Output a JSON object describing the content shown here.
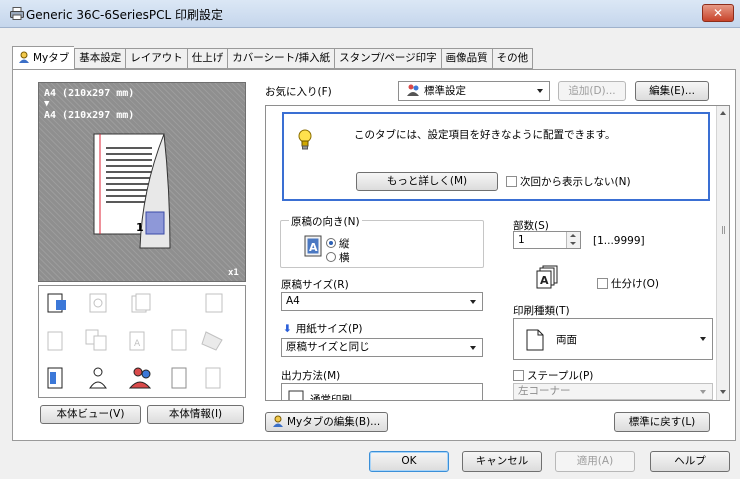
{
  "window": {
    "title": "Generic 36C-6SeriesPCL 印刷設定",
    "close_label": "✕"
  },
  "tabs": [
    {
      "label": "Myタブ",
      "active": true
    },
    {
      "label": "基本設定"
    },
    {
      "label": "レイアウト"
    },
    {
      "label": "仕上げ"
    },
    {
      "label": "カバーシート/挿入紙"
    },
    {
      "label": "スタンプ/ページ印字"
    },
    {
      "label": "画像品質"
    },
    {
      "label": "その他"
    }
  ],
  "preview": {
    "size_top": "A4 (210x297 mm)",
    "arrow": "▼",
    "size_bottom": "A4 (210x297 mm)",
    "copies_mark": "x1"
  },
  "left_buttons": {
    "body_view": "本体ビュー(V)",
    "body_info": "本体情報(I)"
  },
  "favorites": {
    "label": "お気に入り(F)",
    "value": "標準設定",
    "add_label": "追加(D)...",
    "edit_label": "編集(E)..."
  },
  "info": {
    "message": "このタブには、設定項目を好きなように配置できます。",
    "more_label": "もっと詳しく(M)",
    "no_show_label": "次回から表示しない(N)"
  },
  "orientation": {
    "label": "原稿の向き(N)",
    "portrait": "縦",
    "landscape": "横"
  },
  "original_size": {
    "label": "原稿サイズ(R)",
    "value": "A4"
  },
  "paper_size": {
    "label": "用紙サイズ(P)",
    "value": "原稿サイズと同じ"
  },
  "output": {
    "label": "出力方法(M)",
    "value": "通常印刷"
  },
  "copies": {
    "label": "部数(S)",
    "value": "1",
    "range": "[1...9999]",
    "sort_label": "仕分け(O)"
  },
  "print_type": {
    "label": "印刷種類(T)",
    "value": "両面"
  },
  "staple": {
    "label": "ステープル(P)",
    "value": "左コーナー"
  },
  "bottom": {
    "edit_mytab": "Myタブの編集(B)...",
    "reset": "標準に戻す(L)"
  },
  "footer": {
    "ok": "OK",
    "cancel": "キャンセル",
    "apply": "適用(A)",
    "help": "ヘルプ"
  },
  "colors": {
    "accent": "#3a6fd3",
    "tab_border": "#9a9a9a"
  }
}
